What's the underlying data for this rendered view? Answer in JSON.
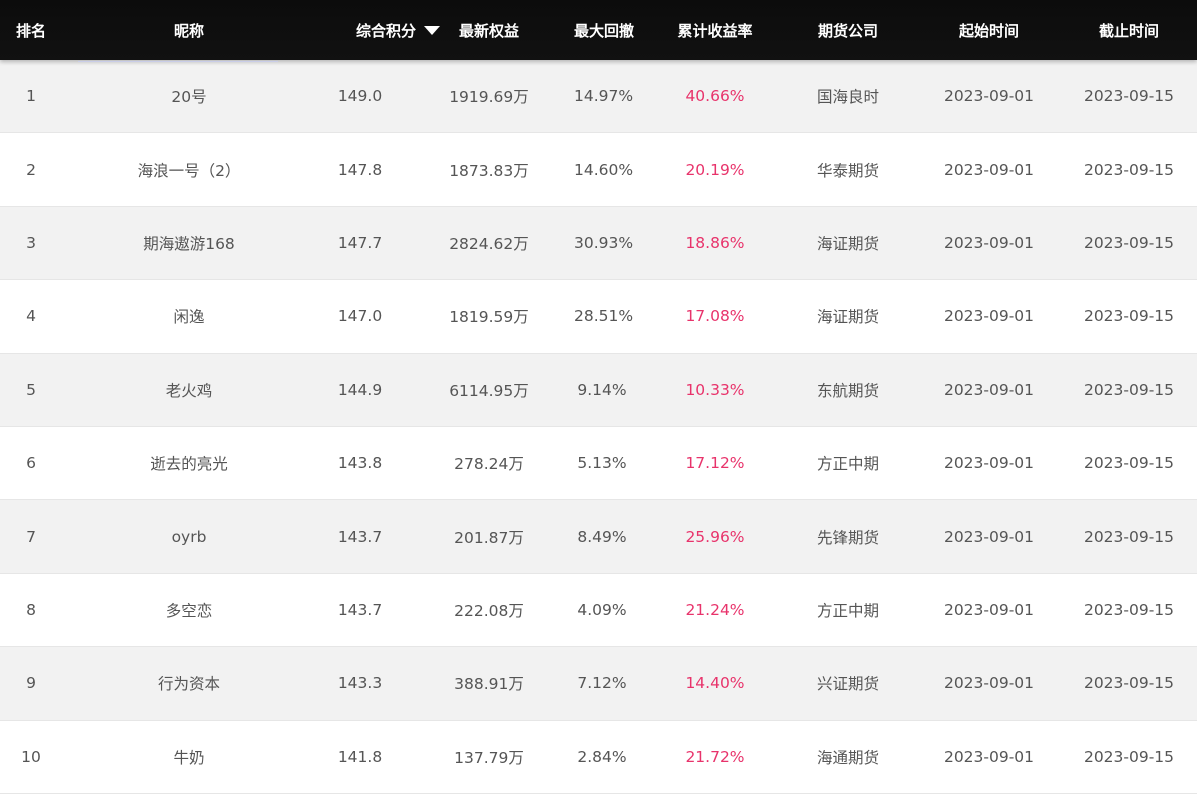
{
  "columns": {
    "rank": "排名",
    "nickname": "昵称",
    "score": "综合积分",
    "equity": "最新权益",
    "max_drawdown": "最大回撤",
    "cum_return": "累计收益率",
    "company": "期货公司",
    "start": "起始时间",
    "end": "截止时间"
  },
  "sort": {
    "icon": "triangle-down-icon",
    "column": "score"
  },
  "colors": {
    "header_bg": "#111111",
    "return_text": "#e8336b",
    "odd_row_bg": "#f2f2f2"
  },
  "rows": [
    {
      "rank": "1",
      "nickname": "20号",
      "score": "149.0",
      "equity": "1919.69万",
      "max_drawdown": "14.97%",
      "cum_return": "40.66%",
      "company": "国海良时",
      "start": "2023-09-01",
      "end": "2023-09-15"
    },
    {
      "rank": "2",
      "nickname": "海浪一号（2）",
      "score": "147.8",
      "equity": "1873.83万",
      "max_drawdown": "14.60%",
      "cum_return": "20.19%",
      "company": "华泰期货",
      "start": "2023-09-01",
      "end": "2023-09-15"
    },
    {
      "rank": "3",
      "nickname": "期海遨游168",
      "score": "147.7",
      "equity": "2824.62万",
      "max_drawdown": "30.93%",
      "cum_return": "18.86%",
      "company": "海证期货",
      "start": "2023-09-01",
      "end": "2023-09-15"
    },
    {
      "rank": "4",
      "nickname": "闲逸",
      "score": "147.0",
      "equity": "1819.59万",
      "max_drawdown": "28.51%",
      "cum_return": "17.08%",
      "company": "海证期货",
      "start": "2023-09-01",
      "end": "2023-09-15"
    },
    {
      "rank": "5",
      "nickname": "老火鸡",
      "score": "144.9",
      "equity": "6114.95万",
      "max_drawdown": "9.14%",
      "cum_return": "10.33%",
      "company": "东航期货",
      "start": "2023-09-01",
      "end": "2023-09-15"
    },
    {
      "rank": "6",
      "nickname": "逝去的亮光",
      "score": "143.8",
      "equity": "278.24万",
      "max_drawdown": "5.13%",
      "cum_return": "17.12%",
      "company": "方正中期",
      "start": "2023-09-01",
      "end": "2023-09-15"
    },
    {
      "rank": "7",
      "nickname": "oyrb",
      "score": "143.7",
      "equity": "201.87万",
      "max_drawdown": "8.49%",
      "cum_return": "25.96%",
      "company": "先锋期货",
      "start": "2023-09-01",
      "end": "2023-09-15"
    },
    {
      "rank": "8",
      "nickname": "多空恋",
      "score": "143.7",
      "equity": "222.08万",
      "max_drawdown": "4.09%",
      "cum_return": "21.24%",
      "company": "方正中期",
      "start": "2023-09-01",
      "end": "2023-09-15"
    },
    {
      "rank": "9",
      "nickname": "行为资本",
      "score": "143.3",
      "equity": "388.91万",
      "max_drawdown": "7.12%",
      "cum_return": "14.40%",
      "company": "兴证期货",
      "start": "2023-09-01",
      "end": "2023-09-15"
    },
    {
      "rank": "10",
      "nickname": "牛奶",
      "score": "141.8",
      "equity": "137.79万",
      "max_drawdown": "2.84%",
      "cum_return": "21.72%",
      "company": "海通期货",
      "start": "2023-09-01",
      "end": "2023-09-15"
    }
  ]
}
